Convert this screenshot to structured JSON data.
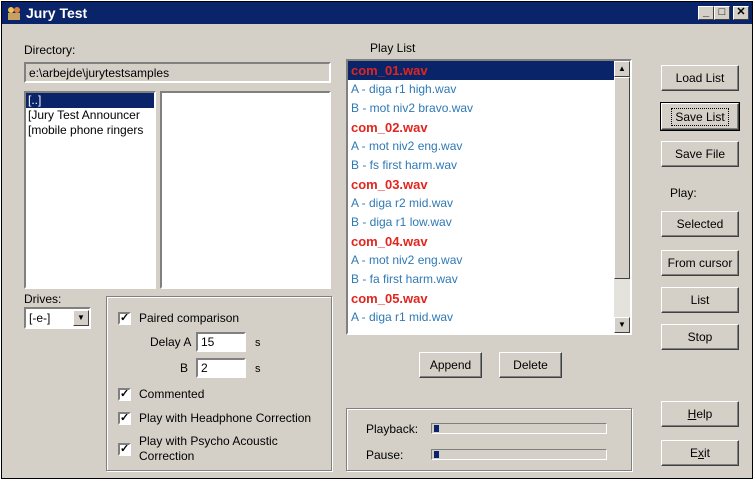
{
  "window": {
    "title": "Jury Test",
    "controls": {
      "minimize": "_",
      "maximize": "□",
      "close": "✕"
    }
  },
  "directory": {
    "label": "Directory:",
    "path": "e:\\arbejde\\jurytestsamples",
    "folders": [
      "[..]",
      "[Jury Test Announcer",
      "[mobile phone ringers"
    ],
    "selected_index": 0
  },
  "drives": {
    "label": "Drives:",
    "value": "[-e-]"
  },
  "options": {
    "paired_comparison": {
      "label": "Paired comparison",
      "checked": true
    },
    "delay_a": {
      "label": "Delay A",
      "value": "15",
      "unit": "s"
    },
    "delay_b": {
      "label": "B",
      "value": "2",
      "unit": "s"
    },
    "commented": {
      "label": "Commented",
      "checked": true
    },
    "headphone_correction": {
      "label": "Play with Headphone Correction",
      "checked": true
    },
    "psycho_acoustic": {
      "label_line1": "Play with Psycho Acoustic",
      "label_line2": "Correction",
      "checked": true
    }
  },
  "playlist": {
    "label": "Play List",
    "items": [
      {
        "text": "com_01.wav",
        "kind": "com",
        "selected": true
      },
      {
        "text": "A - diga r1 high.wav",
        "kind": "sub"
      },
      {
        "text": "B - mot niv2 bravo.wav",
        "kind": "sub"
      },
      {
        "text": "com_02.wav",
        "kind": "com"
      },
      {
        "text": "A - mot niv2 eng.wav",
        "kind": "sub"
      },
      {
        "text": "B - fs first harm.wav",
        "kind": "sub"
      },
      {
        "text": "com_03.wav",
        "kind": "com"
      },
      {
        "text": "A - diga r2 mid.wav",
        "kind": "sub"
      },
      {
        "text": "B - diga r1 low.wav",
        "kind": "sub"
      },
      {
        "text": "com_04.wav",
        "kind": "com"
      },
      {
        "text": "A - mot niv2 eng.wav",
        "kind": "sub"
      },
      {
        "text": "B - fa first harm.wav",
        "kind": "sub"
      },
      {
        "text": "com_05.wav",
        "kind": "com"
      },
      {
        "text": "A - diga r1 mid.wav",
        "kind": "sub"
      }
    ],
    "append_label": "Append",
    "delete_label": "Delete"
  },
  "status": {
    "playback_label": "Playback:",
    "pause_label": "Pause:",
    "playback_progress": 0.02,
    "pause_progress": 0.02
  },
  "buttons": {
    "load_list": "Load List",
    "save_list": "Save List",
    "save_file": "Save File",
    "play_label": "Play:",
    "selected": "Selected",
    "from_cursor": "From cursor",
    "list": "List",
    "stop": "Stop",
    "help_prefix": "",
    "help_underlined": "H",
    "help_rest": "elp",
    "exit_prefix": "E",
    "exit_underlined": "x",
    "exit_rest": "it"
  },
  "colors": {
    "titlebar": "#0a246a",
    "com_item": "#e0261f",
    "sub_item": "#2f79b5",
    "face": "#d4d0c8"
  }
}
